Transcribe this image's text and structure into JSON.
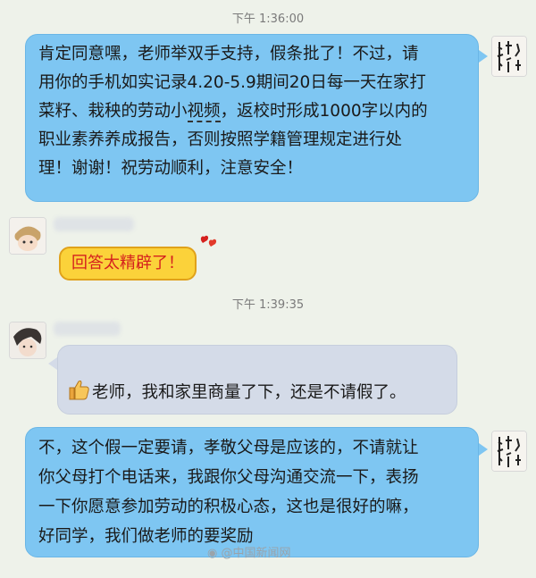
{
  "messages": [
    {
      "time": "下午 1:36:00",
      "lines": [
        "肯定同意嘿，老师举双手支持，假条批了！不过，请",
        "用你的手机如实记录4.20-5.9期间20日每一天在家打",
        "职业素养养成报告，否则按照学籍管理规定进行处",
        "理！谢谢！祝劳动顺利，注意安全！"
      ],
      "line3": {
        "before": "菜籽、栽秧的劳动小",
        "underlined": "视频",
        "after": "，返校时形成1000字以内的"
      }
    },
    {
      "sticker_text": "回答太精辟了！"
    },
    {
      "time": "下午 1:39:35",
      "text": "老师，我和家里商量了下，还是不请假了。"
    },
    {
      "lines": [
        "不，这个假一定要请，孝敬父母是应该的，不请就让",
        "你父母打个电话来，我跟你父母沟通交流一下，表扬",
        "一下你愿意参加劳动的积极心态，这也是很好的嘛，",
        "好同学，我们做老师的要奖励"
      ]
    }
  ],
  "watermark": "@中国新闻网",
  "icons": {
    "thumbs_up": "thumbs-up-icon",
    "sticker_hearts": "hearts-icon"
  },
  "colors": {
    "teacher_bubble": "#7ec6f2",
    "student_bubble": "#d4dbe8",
    "sticker_bubble": "#fbd23a",
    "sticker_text": "#d5211e"
  }
}
